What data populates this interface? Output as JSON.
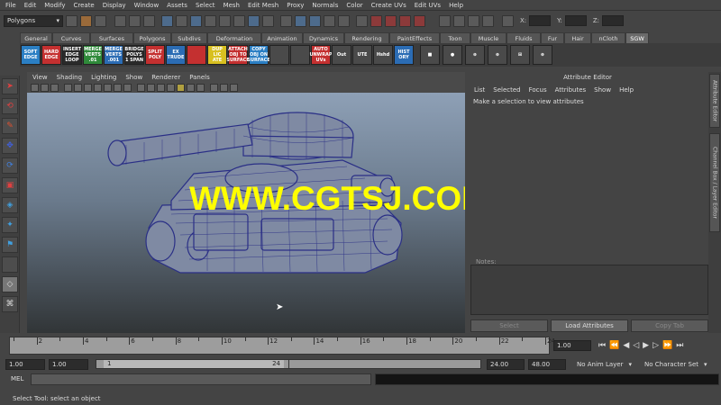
{
  "menubar": [
    "File",
    "Edit",
    "Modify",
    "Create",
    "Display",
    "Window",
    "Assets",
    "Select",
    "Mesh",
    "Edit Mesh",
    "Proxy",
    "Normals",
    "Color",
    "Create UVs",
    "Edit UVs",
    "Help"
  ],
  "status": {
    "mode": "Polygons",
    "x_label": "X:",
    "y_label": "Y:",
    "z_label": "Z:"
  },
  "shelf_tabs": [
    "General",
    "Curves",
    "Surfaces",
    "Polygons",
    "Subdivs",
    "Deformation",
    "Animation",
    "Dynamics",
    "Rendering",
    "PaintEffects",
    "Toon",
    "Muscle",
    "Fluids",
    "Fur",
    "Hair",
    "nCloth",
    "SGW"
  ],
  "shelf_buttons": [
    {
      "label": "SOFT EDGE",
      "color": "#2b7fc4"
    },
    {
      "label": "HARD EDGE",
      "color": "#c43030"
    },
    {
      "label": "INSERT EDGE LOOP",
      "color": "#2a2a2a"
    },
    {
      "label": "MERGE VERTS .01",
      "color": "#2f8a3a"
    },
    {
      "label": "MERGE VERTS .001",
      "color": "#2b6cb4"
    },
    {
      "label": "BRIDGE POLYS 1 SPAN",
      "color": "#2a2a2a"
    },
    {
      "label": "SPLIT POLY",
      "color": "#c43030"
    },
    {
      "label": "EX TRUDE",
      "color": "#2b6cb4"
    },
    {
      "label": "",
      "color": "#c43030"
    },
    {
      "label": "DUP LIC ATE",
      "color": "#d8c020"
    },
    {
      "label": "ATTACH OBJ TO SURFACE",
      "color": "#c43030"
    },
    {
      "label": "COPY OBJ ON SURFACE",
      "color": "#2b7fc4"
    },
    {
      "label": "",
      "color": "#4a4a4a"
    },
    {
      "label": "",
      "color": "#4a4a4a"
    },
    {
      "label": "AUTO UNWRAP UVs",
      "color": "#c43030"
    },
    {
      "label": "Out",
      "color": "#4a4a4a"
    },
    {
      "label": "UTE",
      "color": "#4a4a4a"
    },
    {
      "label": "Hshd",
      "color": "#4a4a4a"
    },
    {
      "label": "HIST ORY",
      "color": "#2b6cb4"
    }
  ],
  "viewport": {
    "menu": [
      "View",
      "Shading",
      "Lighting",
      "Show",
      "Renderer",
      "Panels"
    ],
    "watermark": "WWW.CGTSJ.COM"
  },
  "attribute_editor": {
    "title": "Attribute Editor",
    "menu": [
      "List",
      "Selected",
      "Focus",
      "Attributes",
      "Show",
      "Help"
    ],
    "message": "Make a selection to view attributes",
    "notes_label": "Notes:",
    "buttons": [
      "Select",
      "Load Attributes",
      "Copy Tab"
    ]
  },
  "side_tabs": [
    "Attribute Editor",
    "Channel Box / Layer Editor"
  ],
  "timeline": {
    "ticks": [
      "2",
      "4",
      "6",
      "8",
      "10",
      "12",
      "14",
      "16",
      "18",
      "20",
      "22",
      "24"
    ],
    "current_time": "1.00"
  },
  "range": {
    "start": "1.00",
    "inner_start": "1.00",
    "thumb_start": "1",
    "thumb_end": "24",
    "end": "24.00",
    "max": "48.00",
    "anim_layer": "No Anim Layer",
    "character_set": "No Character Set"
  },
  "cmdline": {
    "label": "MEL"
  },
  "help_line": "Select Tool: select an object"
}
